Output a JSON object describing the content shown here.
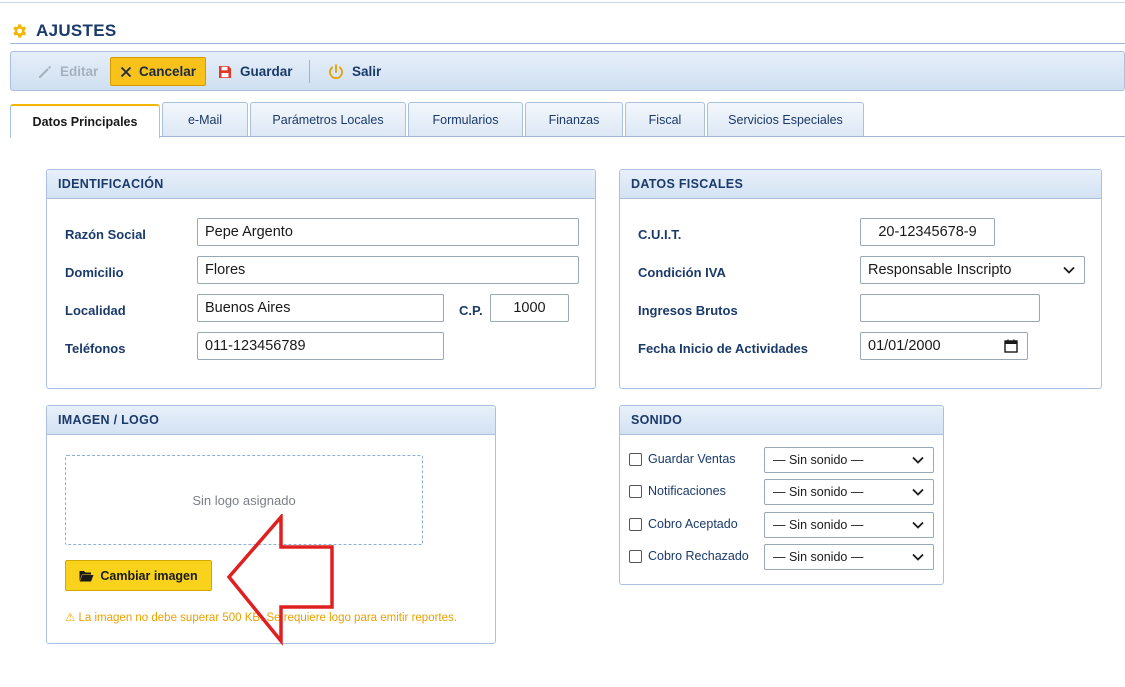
{
  "page": {
    "title": "AJUSTES"
  },
  "toolbar": {
    "edit_label": "Editar",
    "cancel_label": "Cancelar",
    "save_label": "Guardar",
    "exit_label": "Salir"
  },
  "tabs": [
    {
      "label": "Datos Principales",
      "active": true
    },
    {
      "label": "e-Mail"
    },
    {
      "label": "Parámetros Locales"
    },
    {
      "label": "Formularios"
    },
    {
      "label": "Finanzas"
    },
    {
      "label": "Fiscal"
    },
    {
      "label": "Servicios Especiales"
    }
  ],
  "identificacion": {
    "heading": "IDENTIFICACIÓN",
    "razon_social_label": "Razón Social",
    "razon_social_value": "Pepe Argento",
    "domicilio_label": "Domicilio",
    "domicilio_value": "Flores",
    "localidad_label": "Localidad",
    "localidad_value": "Buenos Aires",
    "cp_label": "C.P.",
    "cp_value": "1000",
    "telefonos_label": "Teléfonos",
    "telefonos_value": "011-123456789"
  },
  "fiscales": {
    "heading": "DATOS FISCALES",
    "cuit_label": "C.U.I.T.",
    "cuit_value": "20-12345678-9",
    "iva_label": "Condición IVA",
    "iva_value": "Responsable Inscripto",
    "iibb_label": "Ingresos Brutos",
    "iibb_value": "",
    "fecha_label": "Fecha Inicio de Actividades",
    "fecha_value": "01/01/2000"
  },
  "logo": {
    "heading": "IMAGEN / LOGO",
    "placeholder": "Sin logo asignado",
    "change_label": "Cambiar imagen",
    "warning": "⚠ La imagen no debe superar 500 KB. Se requiere logo para emitir reportes."
  },
  "sonido": {
    "heading": "SONIDO",
    "rows": [
      {
        "label": "Guardar Ventas",
        "value": "— Sin sonido —",
        "checked": false
      },
      {
        "label": "Notificaciones",
        "value": "— Sin sonido —",
        "checked": false
      },
      {
        "label": "Cobro Aceptado",
        "value": "— Sin sonido —",
        "checked": false
      },
      {
        "label": "Cobro Rechazado",
        "value": "— Sin sonido —",
        "checked": false
      }
    ]
  },
  "colors": {
    "accent": "#f8c21a",
    "brand": "#1a3a6b",
    "annotation": "#e02020"
  },
  "icons": [
    "gear-icon",
    "pencil-icon",
    "close-icon",
    "floppy-icon",
    "power-icon",
    "chevron-down-icon",
    "calendar-icon",
    "folder-open-icon"
  ]
}
